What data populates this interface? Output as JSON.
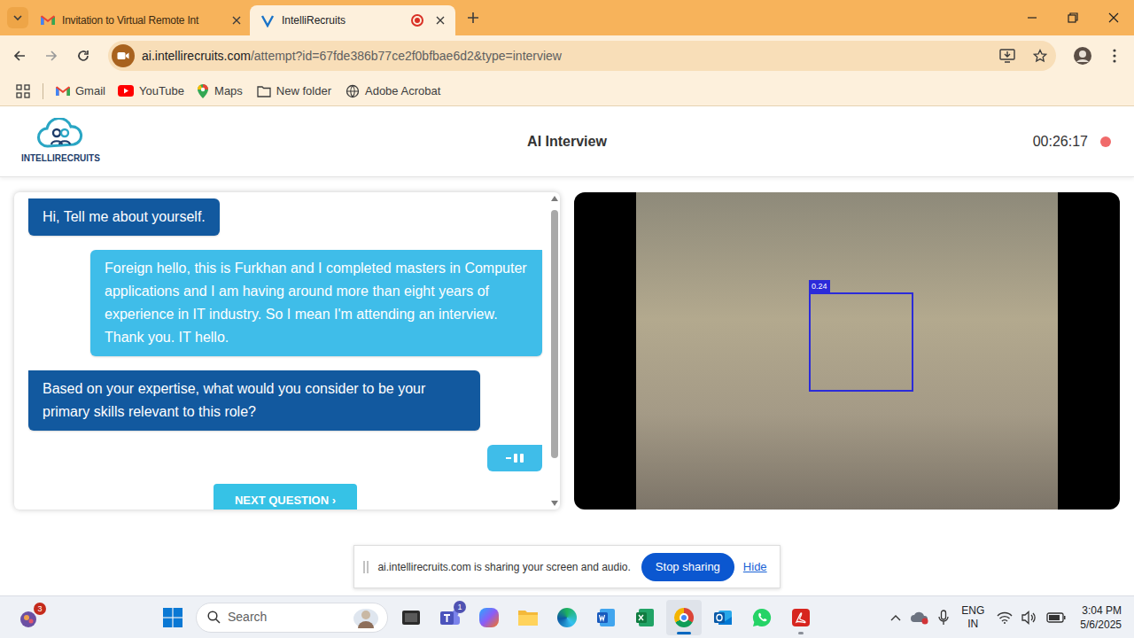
{
  "browser": {
    "tabs": [
      {
        "label": "Invitation to Virtual Remote Int",
        "selected": false
      },
      {
        "label": "IntelliRecruits",
        "selected": true,
        "recording": true
      }
    ],
    "url": {
      "host": "ai.intellirecruits.com",
      "path": "/attempt?id=67fde386b77ce2f0bfbae6d2&type=interview"
    },
    "bookmarks": [
      "Gmail",
      "YouTube",
      "Maps",
      "New folder",
      "Adobe Acrobat"
    ]
  },
  "page": {
    "logo": "INTELLIRECRUITS",
    "title": "AI Interview",
    "timer": "00:26:17",
    "recording": true
  },
  "chat": {
    "messages": [
      {
        "kind": "bot",
        "text": "Hi, Tell me about yourself."
      },
      {
        "kind": "user",
        "text": "Foreign hello, this is Furkhan and I completed masters in Computer applications and I am having around more than eight years of experience in IT industry. So I mean I'm attending an interview. Thank you. IT hello."
      },
      {
        "kind": "bot",
        "text": "Based on your expertise, what would you consider to be your primary skills relevant to this role?"
      }
    ],
    "typing": true,
    "next_button": "NEXT QUESTION ›"
  },
  "video": {
    "detection": {
      "score": "0.24"
    }
  },
  "share_bar": {
    "message": "ai.intellirecruits.com is sharing your screen and audio.",
    "stop": "Stop sharing",
    "hide": "Hide"
  },
  "taskbar": {
    "widgets_badge": "3",
    "search": "Search",
    "teams_badge": "1",
    "chrome_active": true,
    "acrobat_running": true,
    "language": "ENG",
    "region": "IN",
    "time": "3:04 PM",
    "date": "5/6/2025"
  }
}
